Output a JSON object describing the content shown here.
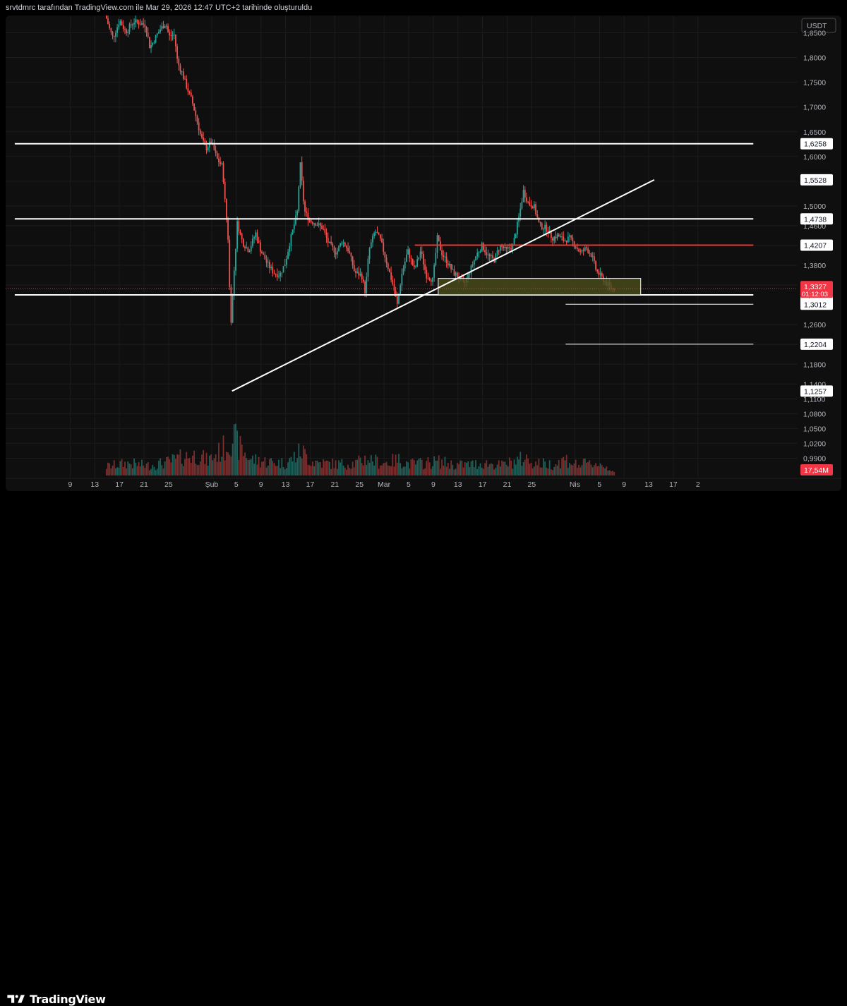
{
  "header": {
    "text": "srvtdmrc tarafından TradingView.com ile Mar 29, 2026 12:47 UTC+2 tarihinde oluşturuldu"
  },
  "branding": {
    "logo_text": "TradingView",
    "logo_icon": "tradingview-logo-icon"
  },
  "chart_data": {
    "type": "candlestick",
    "currency": "USDT",
    "ylim": [
      0.955,
      1.885
    ],
    "y_tick_labels": [
      "1,8500",
      "1,8000",
      "1,7500",
      "1,7000",
      "1,6500",
      "1,6000",
      "1,5500",
      "1,5000",
      "1,4600",
      "1,4200",
      "1,3800",
      "1,3400",
      "1,2600",
      "1,2200",
      "1,1800",
      "1,1400",
      "1,1100",
      "1,0800",
      "1,0500",
      "1,0200",
      "0,9900"
    ],
    "y_tick_values": [
      1.85,
      1.8,
      1.75,
      1.7,
      1.65,
      1.6,
      1.55,
      1.5,
      1.46,
      1.42,
      1.38,
      1.34,
      1.26,
      1.22,
      1.18,
      1.14,
      1.11,
      1.08,
      1.05,
      1.02,
      0.99
    ],
    "x_tick_labels": [
      "9",
      "13",
      "17",
      "21",
      "25",
      "Şub",
      "5",
      "9",
      "13",
      "17",
      "21",
      "25",
      "Mar",
      "5",
      "9",
      "13",
      "17",
      "21",
      "25",
      "Nis",
      "5",
      "9",
      "13",
      "17",
      "2"
    ],
    "x_tick_days": [
      9,
      13,
      17,
      21,
      25,
      32,
      36,
      40,
      44,
      48,
      52,
      56,
      60,
      64,
      68,
      72,
      76,
      80,
      84,
      91,
      95,
      99,
      103,
      107,
      111
    ],
    "current_price": {
      "label": "1,3327",
      "countdown": "01:12:03",
      "value": 1.3327
    },
    "volume_label": "17,54M",
    "levels": [
      {
        "label": "1,6258",
        "value": 1.6258,
        "color": "#ffffff",
        "from_day": 0,
        "to_day": 120
      },
      {
        "label": "1,5528",
        "value": 1.5528,
        "color": "#ffffff",
        "from_day": 0,
        "to_day": 0
      },
      {
        "label": "1,4738",
        "value": 1.4738,
        "color": "#ffffff",
        "from_day": 0,
        "to_day": 120
      },
      {
        "label": "1,4207",
        "value": 1.4207,
        "color": "#e53935",
        "from_day": 65,
        "to_day": 120
      },
      {
        "label": "1,3202",
        "value": 1.3202,
        "color": "#ffffff",
        "from_day": 0,
        "to_day": 120
      },
      {
        "label": "1,3012",
        "value": 1.3012,
        "color": "#ffffff",
        "from_day": 89.5,
        "to_day": 120
      },
      {
        "label": "1,2204",
        "value": 1.2204,
        "color": "#ffffff",
        "from_day": 89.5,
        "to_day": 120
      },
      {
        "label": "1,1257",
        "value": 1.1257,
        "color": "#ffffff",
        "from_day": 0,
        "to_day": 0
      }
    ],
    "trendline": {
      "from": [
        35.3,
        1.1257
      ],
      "to": [
        103.9,
        1.5528
      ]
    },
    "zone": {
      "from_day": 68.8,
      "to_day": 101.7,
      "low": 1.3202,
      "high": 1.3535
    },
    "price_path": [
      [
        14.9,
        1.89
      ],
      [
        15.6,
        1.86
      ],
      [
        16.2,
        1.84
      ],
      [
        17.3,
        1.875
      ],
      [
        18.3,
        1.852
      ],
      [
        19.6,
        1.873
      ],
      [
        21.5,
        1.866
      ],
      [
        22.2,
        1.82
      ],
      [
        23.8,
        1.856
      ],
      [
        24.8,
        1.87
      ],
      [
        25.3,
        1.843
      ],
      [
        26.2,
        1.846
      ],
      [
        26.7,
        1.79
      ],
      [
        27.4,
        1.77
      ],
      [
        28.2,
        1.74
      ],
      [
        29.1,
        1.71
      ],
      [
        29.9,
        1.67
      ],
      [
        30.5,
        1.64
      ],
      [
        31.3,
        1.615
      ],
      [
        32.2,
        1.63
      ],
      [
        33.1,
        1.595
      ],
      [
        34.0,
        1.58
      ],
      [
        34.4,
        1.51
      ],
      [
        35.0,
        1.42
      ],
      [
        35.3,
        1.25
      ],
      [
        35.9,
        1.37
      ],
      [
        36.4,
        1.465
      ],
      [
        37.3,
        1.425
      ],
      [
        38.3,
        1.41
      ],
      [
        39.4,
        1.445
      ],
      [
        40.2,
        1.41
      ],
      [
        41.2,
        1.385
      ],
      [
        42.3,
        1.365
      ],
      [
        43.3,
        1.36
      ],
      [
        44.2,
        1.385
      ],
      [
        45.0,
        1.43
      ],
      [
        46.2,
        1.49
      ],
      [
        46.6,
        1.59
      ],
      [
        47.3,
        1.49
      ],
      [
        48.2,
        1.47
      ],
      [
        49.2,
        1.465
      ],
      [
        50.3,
        1.455
      ],
      [
        51.2,
        1.425
      ],
      [
        52.5,
        1.405
      ],
      [
        53.4,
        1.43
      ],
      [
        54.5,
        1.41
      ],
      [
        55.5,
        1.365
      ],
      [
        56.6,
        1.36
      ],
      [
        57.2,
        1.325
      ],
      [
        57.8,
        1.41
      ],
      [
        58.8,
        1.45
      ],
      [
        59.7,
        1.43
      ],
      [
        60.8,
        1.38
      ],
      [
        61.7,
        1.34
      ],
      [
        62.4,
        1.3
      ],
      [
        63.1,
        1.36
      ],
      [
        64.1,
        1.41
      ],
      [
        65.2,
        1.37
      ],
      [
        66.2,
        1.41
      ],
      [
        67.1,
        1.36
      ],
      [
        68.2,
        1.35
      ],
      [
        68.9,
        1.435
      ],
      [
        69.6,
        1.405
      ],
      [
        70.6,
        1.385
      ],
      [
        71.5,
        1.365
      ],
      [
        72.5,
        1.355
      ],
      [
        73.2,
        1.34
      ],
      [
        74.1,
        1.365
      ],
      [
        75.2,
        1.4
      ],
      [
        76.2,
        1.42
      ],
      [
        77.1,
        1.4
      ],
      [
        78.1,
        1.39
      ],
      [
        79.1,
        1.42
      ],
      [
        80.1,
        1.41
      ],
      [
        81.2,
        1.42
      ],
      [
        82.2,
        1.48
      ],
      [
        82.9,
        1.53
      ],
      [
        83.7,
        1.505
      ],
      [
        84.6,
        1.5
      ],
      [
        85.5,
        1.46
      ],
      [
        86.6,
        1.455
      ],
      [
        87.6,
        1.435
      ],
      [
        88.5,
        1.44
      ],
      [
        89.5,
        1.43
      ],
      [
        90.4,
        1.435
      ],
      [
        91.3,
        1.42
      ],
      [
        92.2,
        1.405
      ],
      [
        93.1,
        1.415
      ],
      [
        94.0,
        1.4
      ],
      [
        94.7,
        1.37
      ],
      [
        95.6,
        1.355
      ],
      [
        96.6,
        1.34
      ],
      [
        97.4,
        1.3327
      ]
    ],
    "volume_path": [
      [
        14.9,
        0.22
      ],
      [
        18.3,
        0.3
      ],
      [
        21.5,
        0.24
      ],
      [
        24.8,
        0.32
      ],
      [
        27.4,
        0.45
      ],
      [
        29.9,
        0.5
      ],
      [
        31.3,
        0.36
      ],
      [
        33.1,
        0.55
      ],
      [
        34.4,
        0.72
      ],
      [
        35.3,
        1.0
      ],
      [
        36.4,
        0.7
      ],
      [
        38.3,
        0.4
      ],
      [
        40.2,
        0.35
      ],
      [
        42.3,
        0.32
      ],
      [
        44.2,
        0.3
      ],
      [
        46.6,
        0.6
      ],
      [
        48.2,
        0.35
      ],
      [
        50.3,
        0.3
      ],
      [
        52.5,
        0.28
      ],
      [
        55.5,
        0.3
      ],
      [
        57.2,
        0.42
      ],
      [
        59.7,
        0.3
      ],
      [
        62.4,
        0.38
      ],
      [
        64.1,
        0.28
      ],
      [
        66.2,
        0.3
      ],
      [
        68.9,
        0.34
      ],
      [
        71.5,
        0.26
      ],
      [
        74.1,
        0.27
      ],
      [
        76.2,
        0.3
      ],
      [
        79.1,
        0.25
      ],
      [
        82.9,
        0.42
      ],
      [
        84.6,
        0.3
      ],
      [
        87.6,
        0.27
      ],
      [
        89.5,
        0.4
      ],
      [
        91.3,
        0.26
      ],
      [
        94.7,
        0.3
      ],
      [
        97.4,
        0.12
      ]
    ],
    "colors": {
      "up": "#26a69a",
      "down": "#ef5350",
      "background": "#0f0f0f",
      "grid": "#1c1c1c",
      "zone_fill": "#4a4d1a",
      "price_box": "#f23645"
    }
  }
}
